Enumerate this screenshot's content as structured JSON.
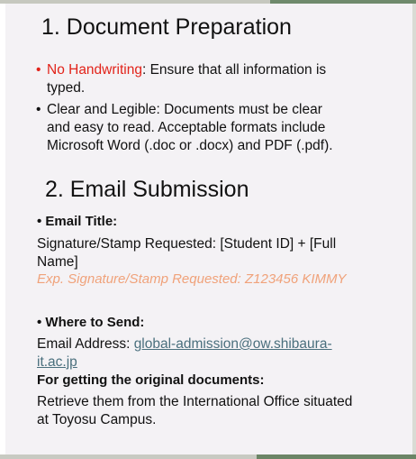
{
  "section1": {
    "heading": "1. Document Preparation",
    "bullets": [
      {
        "dot": "•",
        "highlight": "No Handwriting",
        "rest": ": Ensure that all information is",
        "line2": "typed."
      },
      {
        "dot": "•",
        "line1": "Clear and Legible: Documents must be clear",
        "line2": "and easy to read. Acceptable formats include",
        "line3": "Microsoft Word (.doc or .docx) and PDF (.pdf)."
      }
    ]
  },
  "section2": {
    "heading": "2. Email  Submission",
    "email_title": {
      "label": "• Email Title:",
      "line1": "Signature/Stamp Requested: [Student ID] + [Full",
      "line2": "Name]",
      "example": "Exp. Signature/Stamp Requested: Z123456  KIMMY"
    },
    "where_to_send": {
      "label": "• Where to Send:",
      "prefix": "Email Address: ",
      "link_line1": "global-admission@ow.shibaura-",
      "link_line2": "it.ac.jp"
    },
    "original_docs": {
      "label": "For getting the original documents:",
      "line1": "Retrieve them from the International Office situated",
      "line2": "at Toyosu Campus."
    }
  },
  "colors": {
    "accent_red": "#e2231a",
    "example_orange": "#f0a27a",
    "link": "#4a6f7d"
  }
}
